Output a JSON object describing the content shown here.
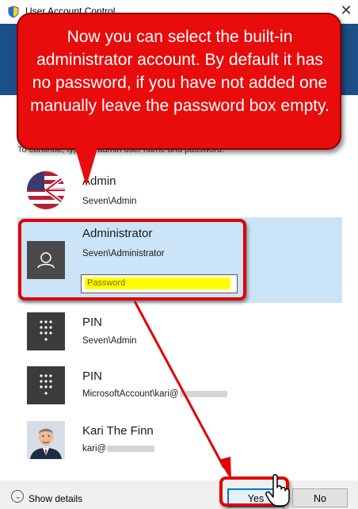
{
  "window": {
    "title": "User Account Control",
    "close_glyph": "✕"
  },
  "prompt": "To continue, type an admin user name and password.",
  "accounts": [
    {
      "name": "Admin",
      "sub": "Seven\\Admin",
      "avatar": "flag-avatar-icon"
    },
    {
      "name": "Administrator",
      "sub": "Seven\\Administrator",
      "avatar": "user-silhouette-icon",
      "selected": true
    },
    {
      "name": "PIN",
      "sub": "Seven\\Admin",
      "avatar": "keypad-icon"
    },
    {
      "name": "PIN",
      "sub": "MicrosoftAccount\\kari@",
      "avatar": "keypad-icon"
    },
    {
      "name": "Kari The Finn",
      "sub": "kari@",
      "avatar": "person-photo-icon"
    }
  ],
  "password": {
    "placeholder": "Password",
    "value": ""
  },
  "footer": {
    "show_details": "Show details",
    "yes": "Yes",
    "no": "No"
  },
  "callout": {
    "text": "Now you can select the built-in administrator account. By default it has no password, if you have not added one manually leave the password box empty."
  },
  "colors": {
    "callout": "#e80c0c",
    "selected_row": "#cce4f7",
    "password_highlight": "#ffff00",
    "banner": "#1c4f87"
  }
}
